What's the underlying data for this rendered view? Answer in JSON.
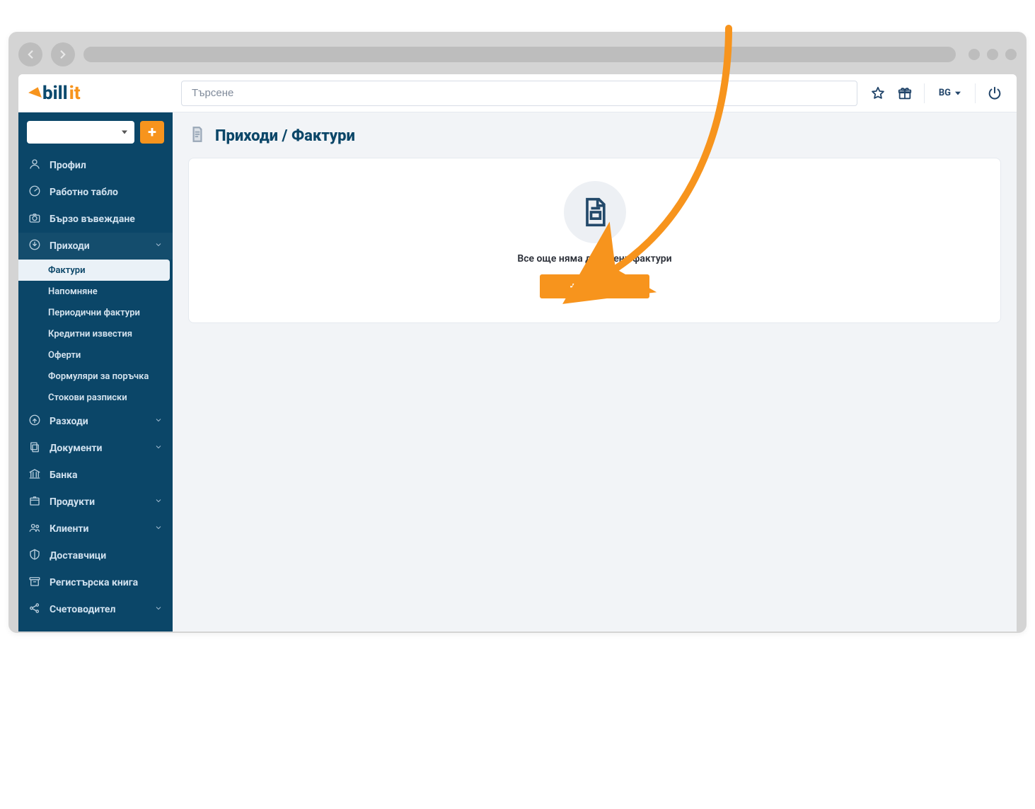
{
  "topbar": {
    "search_placeholder": "Търсене",
    "language_label": "BG"
  },
  "sidebar": {
    "items": [
      {
        "label": "Профил",
        "icon": "user",
        "expandable": false
      },
      {
        "label": "Работно табло",
        "icon": "gauge",
        "expandable": false
      },
      {
        "label": "Бързо въвеждане",
        "icon": "camera",
        "expandable": false
      },
      {
        "label": "Приходи",
        "icon": "download",
        "expandable": true,
        "open": true,
        "children": [
          {
            "label": "Фактури",
            "active": true
          },
          {
            "label": "Напомняне"
          },
          {
            "label": "Периодични фактури"
          },
          {
            "label": "Кредитни известия"
          },
          {
            "label": "Оферти"
          },
          {
            "label": "Формуляри за поръчка"
          },
          {
            "label": "Стокови разписки"
          }
        ]
      },
      {
        "label": "Разходи",
        "icon": "upload",
        "expandable": true
      },
      {
        "label": "Документи",
        "icon": "copy",
        "expandable": true
      },
      {
        "label": "Банка",
        "icon": "bank",
        "expandable": false
      },
      {
        "label": "Продукти",
        "icon": "box",
        "expandable": true
      },
      {
        "label": "Клиенти",
        "icon": "people",
        "expandable": true
      },
      {
        "label": "Доставчици",
        "icon": "truck",
        "expandable": false
      },
      {
        "label": "Регистърска книга",
        "icon": "archive",
        "expandable": false
      },
      {
        "label": "Счетоводител",
        "icon": "share",
        "expandable": true
      }
    ]
  },
  "main": {
    "page_title": "Приходи / Фактури",
    "empty_message": "Все още няма добавени фактури",
    "add_button_label": "Добави"
  },
  "colors": {
    "accent": "#f7941d",
    "sidebar": "#0b4668"
  }
}
